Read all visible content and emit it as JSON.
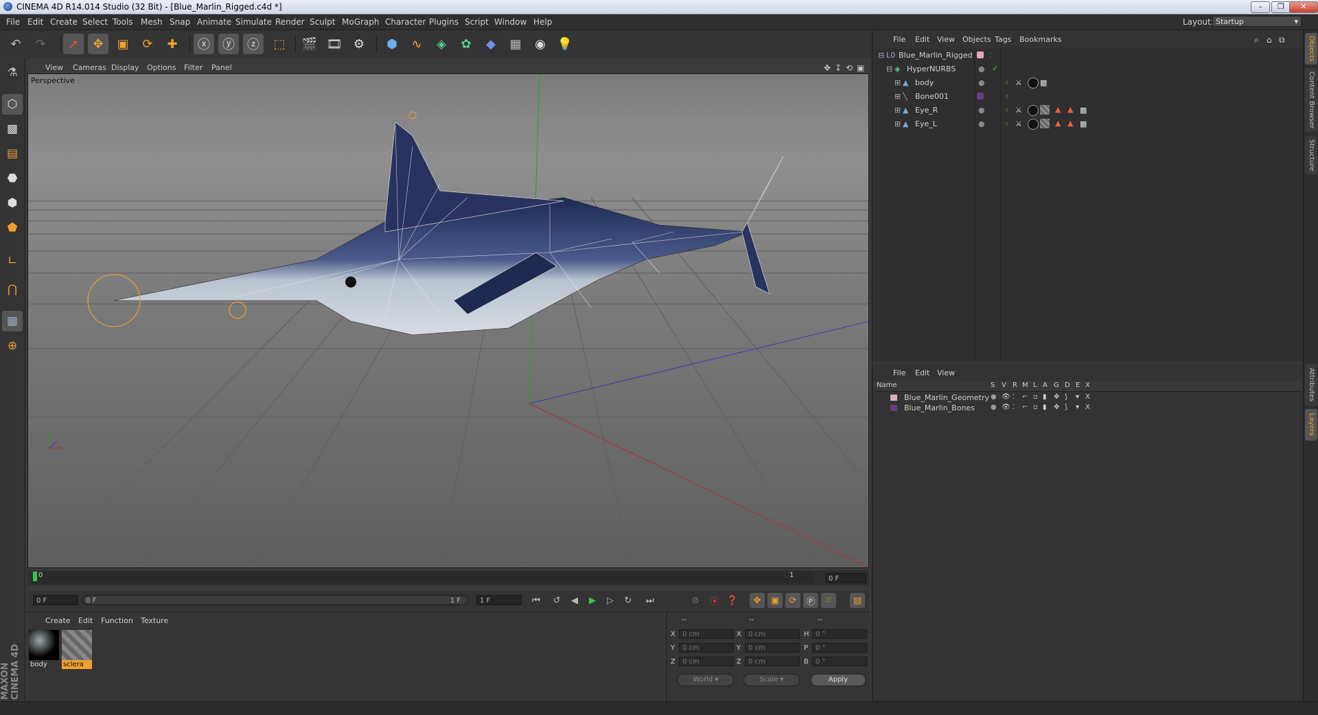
{
  "window": {
    "title": "CINEMA 4D R14.014 Studio (32 Bit) - [Blue_Marlin_Rigged.c4d *]"
  },
  "menubar": {
    "items": [
      "File",
      "Edit",
      "Create",
      "Select",
      "Tools",
      "Mesh",
      "Snap",
      "Animate",
      "Simulate",
      "Render",
      "Sculpt",
      "MoGraph",
      "Character",
      "Plugins",
      "Script",
      "Window",
      "Help"
    ],
    "layout_label": "Layout:",
    "layout_value": "Startup"
  },
  "viewport": {
    "menu": [
      "View",
      "Cameras",
      "Display",
      "Options",
      "Filter",
      "Panel"
    ],
    "label": "Perspective"
  },
  "timeline": {
    "start_marker": "0",
    "end_marker": "1",
    "current_frame": "0 F"
  },
  "transport": {
    "start_field": "0 F",
    "range_left": "0 F",
    "range_right": "1 F",
    "end_field": "1 F"
  },
  "material_manager": {
    "menu": [
      "Create",
      "Edit",
      "Function",
      "Texture"
    ],
    "materials": [
      {
        "name": "body"
      },
      {
        "name": "sclera"
      }
    ],
    "brand": "MAXON CINEMA 4D"
  },
  "coordinates": {
    "headers": [
      "--",
      "--",
      "--"
    ],
    "rows": [
      {
        "a": "X",
        "av": "0 cm",
        "b": "X",
        "bv": "0 cm",
        "c": "H",
        "cv": "0 °"
      },
      {
        "a": "Y",
        "av": "0 cm",
        "b": "Y",
        "bv": "0 cm",
        "c": "P",
        "cv": "0 °"
      },
      {
        "a": "Z",
        "av": "0 cm",
        "b": "Z",
        "bv": "0 cm",
        "c": "B",
        "cv": "0 °"
      }
    ],
    "mode1": "World",
    "mode2": "Scale",
    "apply": "Apply"
  },
  "object_manager": {
    "menu": [
      "File",
      "Edit",
      "View",
      "Objects",
      "Tags",
      "Bookmarks"
    ],
    "objects": [
      {
        "name": "Blue_Marlin_Rigged"
      },
      {
        "name": "HyperNURBS"
      },
      {
        "name": "body"
      },
      {
        "name": "Bone001"
      },
      {
        "name": "Eye_R"
      },
      {
        "name": "Eye_L"
      }
    ]
  },
  "layer_manager": {
    "menu": [
      "File",
      "Edit",
      "View"
    ],
    "columns": [
      "Name",
      "S",
      "V",
      "R",
      "M",
      "L",
      "A",
      "G",
      "D",
      "E",
      "X"
    ],
    "layers": [
      {
        "name": "Blue_Marlin_Geometry",
        "color": "#e0a8c0"
      },
      {
        "name": "Blue_Marlin_Bones",
        "color": "#6b3a8a"
      }
    ]
  },
  "side_tabs": [
    "Objects",
    "Content Browser",
    "Structure",
    "Attributes",
    "Layers"
  ]
}
